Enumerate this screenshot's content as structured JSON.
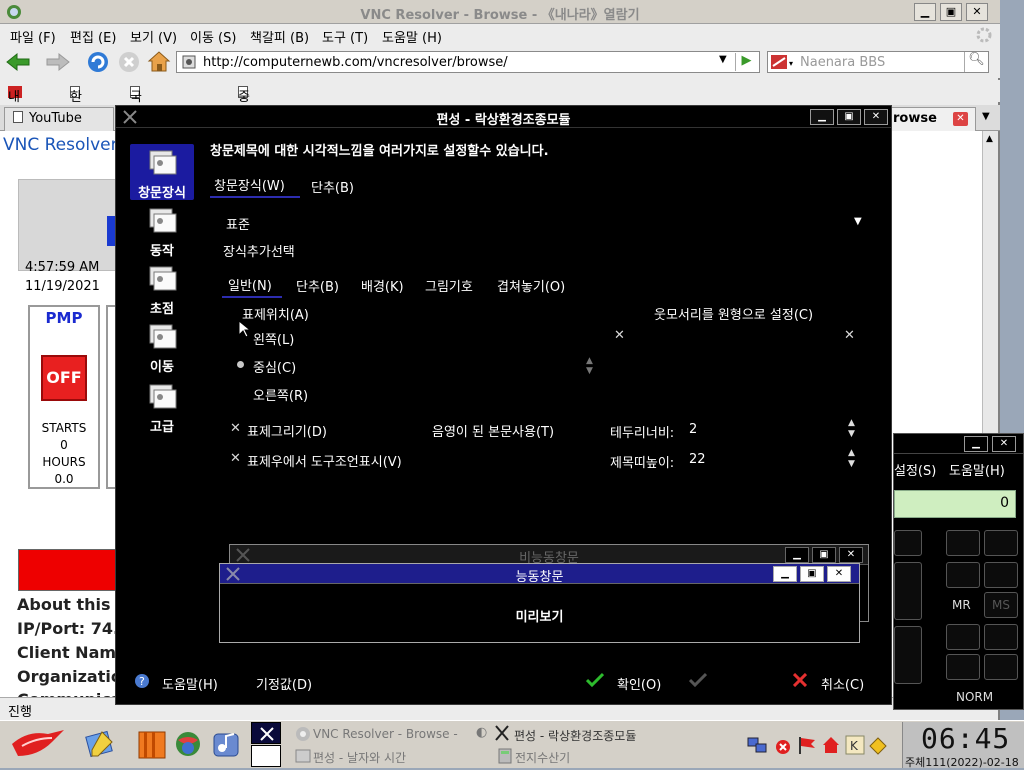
{
  "browser": {
    "title": "VNC Resolver - Browse - 《내나라》열람기",
    "menu": [
      "파일 (F)",
      "편집 (E)",
      "보기 (V)",
      "이동 (S)",
      "책갈피 (B)",
      "도구 (T)",
      "도움말 (H)"
    ],
    "url": "http://computernewb.com/vncresolver/browse/",
    "search_placeholder": "Naenara BBS",
    "bookmarks": [
      "내나라",
      "한마음",
      "국가망정보쎈터",
      "중앙과학기술통보사"
    ],
    "tabs": {
      "left": "YouTube",
      "right": "rowse"
    },
    "status": "진행"
  },
  "page": {
    "title": "VNC Resolver",
    "time": "4:57:59 AM",
    "date": "11/19/2021",
    "pmp": "PMP",
    "off": "OFF",
    "starts_label": "STARTS",
    "starts_value": "0",
    "hours_label": "HOURS",
    "hours_value": "0.0",
    "about": "About this",
    "ipport": "IP/Port: 74.",
    "client": "Client Nam",
    "org": "Organizatio",
    "comm": "Communicat"
  },
  "calc": {
    "menu_settings": "설정(S)",
    "menu_help": "도움말(H)",
    "display": "0",
    "mr": "MR",
    "ms": "MS",
    "norm": "NORM"
  },
  "dialog": {
    "title": "편성 - 락상환경조종모듈",
    "header": "창문제목에 대한 시각적느낌을 여러가지로 설정할수 있습니다.",
    "sidebar": [
      "창문장식",
      "동작",
      "초점",
      "이동",
      "고급"
    ],
    "tabs": [
      "창문장식(W)",
      "단추(B)"
    ],
    "theme": "표준",
    "addon": "장식추가선택",
    "subtabs": [
      "일반(N)",
      "단추(B)",
      "배경(K)",
      "그림기호",
      "겹쳐놓기(O)"
    ],
    "title_position": "표제위치(A)",
    "round_corners": "웃모서리를 원형으로 설정(C)",
    "left": "왼쪽(L)",
    "center": "중심(C)",
    "right": "오른쪽(R)",
    "draw_title": "표제그리기(D)",
    "shadow_body": "음영이 된 본문사용(T)",
    "border_width_label": "테두리너비:",
    "border_width": "2",
    "tooltip": "표제우에서 도구조언표시(V)",
    "titlebar_height_label": "제목띠높이:",
    "titlebar_height": "22",
    "inactive_title": "비능동창문",
    "active_title": "능동창문",
    "preview": "미리보기",
    "help_btn": "도움말(H)",
    "defaults_btn": "기정값(D)",
    "ok_btn": "확인(O)",
    "cancel_btn": "취소(C)"
  },
  "taskbar": {
    "task1": "VNC Resolver - Browse -",
    "task2": "편성 - 락상환경조종모듈",
    "task3": "편성 - 날자와 시간",
    "task4": "전지수산기",
    "time": "06:45",
    "date": "주체111(2022)-02-18"
  }
}
